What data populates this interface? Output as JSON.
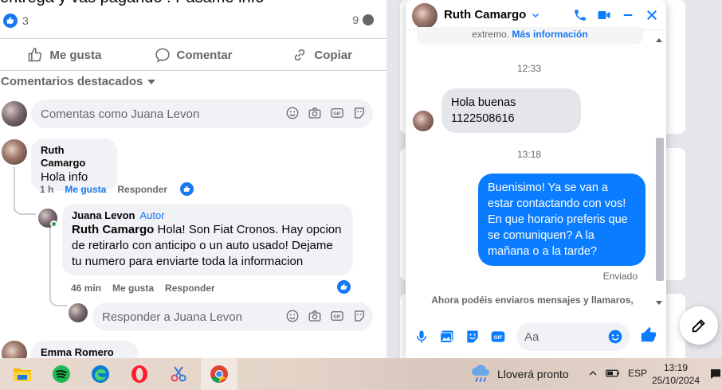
{
  "post": {
    "title_fragment": "entrega y vas pagando . Pasame info",
    "reaction_count": "3",
    "comment_count": "9",
    "actions": {
      "like": "Me gusta",
      "comment": "Comentar",
      "copy": "Copiar"
    },
    "featured_label": "Comentarios destacados",
    "composer_placeholder": "Comentas como Juana Levon"
  },
  "comments": [
    {
      "name": "Ruth Camargo",
      "text": "Hola info",
      "time": "1 h",
      "like": "Me gusta",
      "reply": "Responder"
    },
    {
      "name": "Juana Levon",
      "badge": "Autor",
      "mention": "Ruth Camargo",
      "text": " Hola! Son Fiat Cronos. Hay opcion de retirarlo con anticipo o un auto usado! Dejame tu numero para enviarte toda la informacion",
      "time": "46 min",
      "like": "Me gusta",
      "reply": "Responder"
    }
  ],
  "reply_placeholder": "Responder a Juana Levon",
  "third_comment_name": "Emma Romero",
  "chat": {
    "contact": "Ruth Camargo",
    "truncated_note": "extremo.",
    "truncated_link": "Más información",
    "time1": "12:33",
    "msg_in": "Hola buenas 1122508616",
    "time2": "13:18",
    "msg_out": "Buenisimo! Ya se van a estar contactando con vos! En que horario preferis que se comuniquen? A la mañana o a la tarde?",
    "status": "Enviado",
    "notice": "Ahora podéis enviaros mensajes y llamaros,",
    "input_placeholder": "Aa"
  },
  "taskbar": {
    "weather": "Lloverá pronto",
    "lang": "ESP",
    "time": "13:19",
    "date": "25/10/2024"
  },
  "colors": {
    "accent": "#1877f2",
    "messenger_blue": "#0a7cff",
    "online": "#31a24c"
  }
}
